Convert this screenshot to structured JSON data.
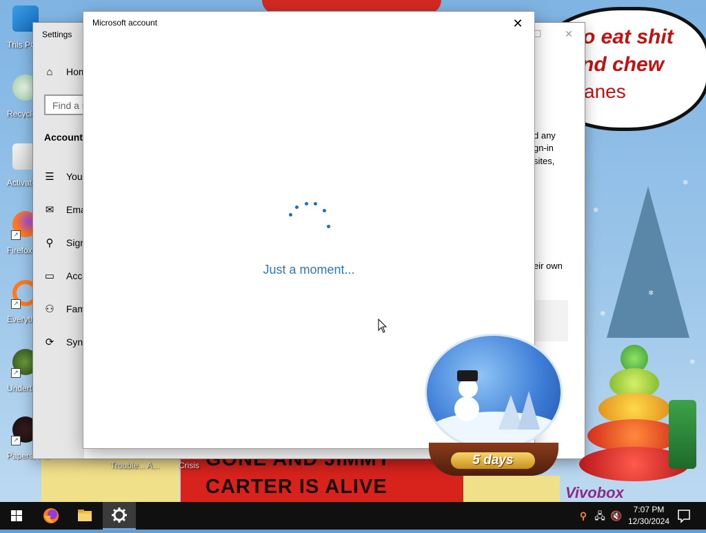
{
  "desktop": {
    "icons": [
      {
        "label": "This PC"
      },
      {
        "label": "Recycle Bin"
      },
      {
        "label": "Activate"
      },
      {
        "label": "Firefox"
      },
      {
        "label": "Everything"
      },
      {
        "label": "Undertale"
      },
      {
        "label": "Papers, Please"
      }
    ],
    "extra_labels": [
      "Trouble... A...",
      "Crisis"
    ]
  },
  "wallpaper": {
    "bubble_lines": [
      "o eat shit",
      "nd chew",
      "anes"
    ],
    "banner_lines": [
      "GONE AND JIMMY",
      "CARTER IS ALIVE"
    ],
    "countdown": "5 days",
    "watermark": "Vivobox"
  },
  "settings_window": {
    "title": "Settings",
    "search_placeholder": "Find a setting",
    "section_heading": "Accounts",
    "nav": [
      {
        "icon": "home-icon",
        "label": "Home"
      },
      {
        "icon": "person-card-icon",
        "label": "Your info"
      },
      {
        "icon": "mail-icon",
        "label": "Email & accounts"
      },
      {
        "icon": "key-icon",
        "label": "Sign-in options"
      },
      {
        "icon": "briefcase-icon",
        "label": "Access work or school"
      },
      {
        "icon": "family-icon",
        "label": "Family & other users"
      },
      {
        "icon": "sync-icon",
        "label": "Sync your settings"
      }
    ],
    "right_text": [
      "d any",
      "gn-in",
      "sites,",
      "eir own"
    ]
  },
  "dialog": {
    "title": "Microsoft account",
    "loading_text": "Just a moment..."
  },
  "taskbar": {
    "apps": [
      {
        "name": "firefox-icon"
      },
      {
        "name": "file-explorer-icon"
      },
      {
        "name": "settings-icon",
        "active": true
      }
    ],
    "tray": [
      "search-icon",
      "network-icon",
      "volume-muted-icon"
    ],
    "time": "7:07 PM",
    "date": "12/30/2024"
  },
  "colors": {
    "taskbar_bg": "#101010",
    "accent": "#2e78b4",
    "spinner": "#1f6bc0"
  }
}
